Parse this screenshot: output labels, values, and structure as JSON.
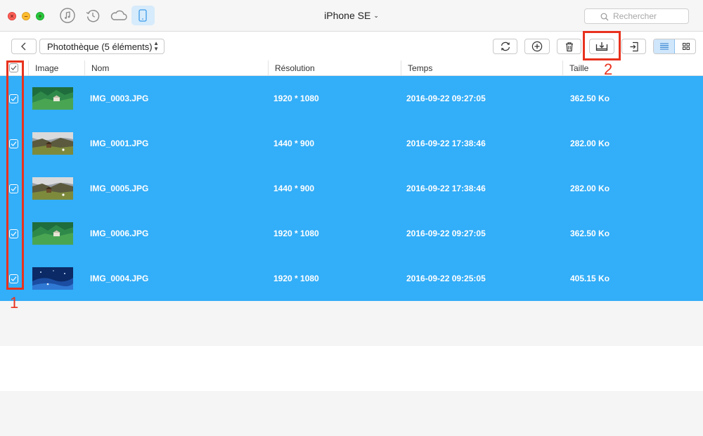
{
  "window": {
    "device_name": "iPhone SE",
    "device_chevron": "⌄",
    "search_placeholder": "Rechercher",
    "top_icons": [
      "music-icon",
      "history-icon",
      "cloud-icon",
      "phone-icon"
    ]
  },
  "toolbar": {
    "album_label": "Photothèque (5 éléments)",
    "actions": [
      "refresh-icon",
      "add-icon",
      "trash-icon",
      "export-to-computer-icon",
      "send-to-device-icon"
    ],
    "active_view": "list"
  },
  "table": {
    "headers": {
      "image": "Image",
      "name": "Nom",
      "resolution": "Résolution",
      "time": "Temps",
      "size": "Taille"
    },
    "rows": [
      {
        "name": "IMG_0003.JPG",
        "resolution": "1920 * 1080",
        "time": "2016-09-22 09:27:05",
        "size": "362.50 Ko",
        "selected": true,
        "thumb": "green-mountain"
      },
      {
        "name": "IMG_0001.JPG",
        "resolution": "1440 * 900",
        "time": "2016-09-22 17:38:46",
        "size": "282.00 Ko",
        "selected": true,
        "thumb": "cloudy-hut"
      },
      {
        "name": "IMG_0005.JPG",
        "resolution": "1440 * 900",
        "time": "2016-09-22 17:38:46",
        "size": "282.00 Ko",
        "selected": true,
        "thumb": "cloudy-hut"
      },
      {
        "name": "IMG_0006.JPG",
        "resolution": "1920 * 1080",
        "time": "2016-09-22 09:27:05",
        "size": "362.50 Ko",
        "selected": true,
        "thumb": "green-mountain"
      },
      {
        "name": "IMG_0004.JPG",
        "resolution": "1920 * 1080",
        "time": "2016-09-22 09:25:05",
        "size": "405.15 Ko",
        "selected": true,
        "thumb": "blue-night"
      }
    ]
  },
  "annotations": {
    "step1": "1",
    "step2": "2",
    "color": "#e8321e"
  },
  "colors": {
    "selection": "#33aef8",
    "titlebar": "#f6f6f6",
    "active_toggle": "#cfe6fb"
  }
}
